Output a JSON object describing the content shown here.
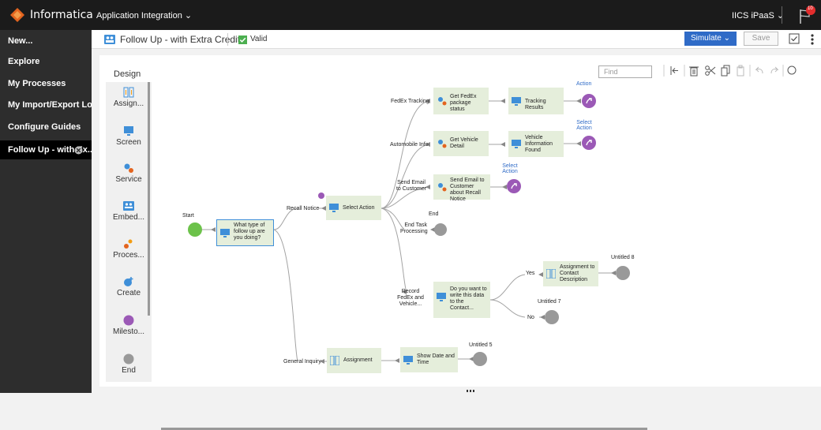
{
  "app": {
    "brand": "Informatica",
    "product": "Application Integration",
    "user": "IICS iPaaS",
    "notification_count": "10"
  },
  "sidebar": {
    "items": [
      {
        "label": "New..."
      },
      {
        "label": "Explore"
      },
      {
        "label": "My Processes"
      },
      {
        "label": "My Import/Export Logs"
      },
      {
        "label": "Configure Guides"
      },
      {
        "label": "Follow Up - with Ex..."
      }
    ]
  },
  "toolbar": {
    "process_title": "Follow Up - with Extra Credit",
    "status": "Valid",
    "simulate_label": "Simulate",
    "save_label": "Save"
  },
  "designer": {
    "title": "Design",
    "find_placeholder": "Find"
  },
  "palette": {
    "items": [
      {
        "label": "Assign..."
      },
      {
        "label": "Screen"
      },
      {
        "label": "Service"
      },
      {
        "label": "Embed..."
      },
      {
        "label": "Proces..."
      },
      {
        "label": "Create"
      },
      {
        "label": "Milesto..."
      },
      {
        "label": "End"
      }
    ]
  },
  "flow": {
    "start_label": "Start",
    "step1": "What type of follow up are you doing?",
    "recall_notice": "Recall Notice",
    "select_action": "Select Action",
    "fedex_tracking": "FedEx Tracking",
    "get_fedex": "Get FedEx package status",
    "tracking_results": "Tracking Results",
    "action_top": "Action",
    "automobile_info": "Automobile Info",
    "get_vehicle": "Get Vehicle Detail",
    "vehicle_info": "Vehicle Information Found",
    "select_action_link": "Select Action",
    "send_email_to_customer": "Send Email to Customer",
    "send_email_node": "Send Email to Customer about Recall Notice",
    "end_label": "End",
    "end_task": "End Task Processing",
    "record_fedex": "Record FedEx and Vehicle...",
    "do_you_want": "Do you want to write this data to the Contact...",
    "yes": "Yes",
    "no": "No",
    "assignment_contact": "Assignment to Contact Description",
    "untitled8": "Untitled 8",
    "untitled7": "Untitled 7",
    "general_inquiry": "General Inquiry",
    "assignment": "Assignment",
    "show_date": "Show Date and Time",
    "untitled5": "Untitled 5"
  },
  "colors": {
    "node_fill": "#e5eedb",
    "start": "#6cc24a",
    "end": "#999999",
    "milestone": "#9b59b6",
    "primary": "#2f6bc7"
  }
}
